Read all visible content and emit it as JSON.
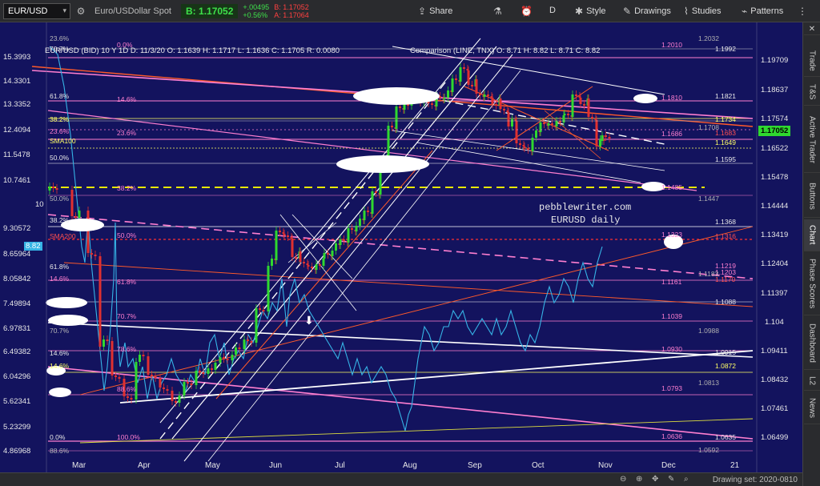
{
  "toolbar": {
    "symbol": "EUR/USD",
    "description": "Euro/USDollar Spot",
    "bid_label": "B:",
    "bid": "1.17052",
    "change": "+.00495",
    "change_pct": "+0.56%",
    "ask_label": "A:",
    "ask": "1.17064",
    "share": "Share",
    "period": "D",
    "style": "Style",
    "drawings": "Drawings",
    "studies": "Studies",
    "patterns": "Patterns"
  },
  "legend": {
    "main": "EUR/USD (BID)  10 Y 1D   D: 11/3/20   O: 1.1639   H: 1.1717   L: 1.1636   C: 1.1705   R: 0.0080",
    "comparison": "Comparison (LINE, TNX)   O: 8.71   H: 8.82   L: 8.71   C: 8.82"
  },
  "watermark": {
    "line1": "pebblewriter.com",
    "line2": "EURUSD daily"
  },
  "left_axis": [
    "15.3993",
    "14.3301",
    "13.3352",
    "12.4094",
    "11.5478",
    "10.7461",
    "10",
    "9.30572",
    "8.65964",
    "8.05842",
    "7.49894",
    "6.97831",
    "6.49382",
    "6.04296",
    "5.62341",
    "5.23299",
    "4.86968"
  ],
  "tnx_value": "8.82",
  "right_axis": [
    "1.19709",
    "1.18637",
    "1.17574",
    "1.16522",
    "1.15478",
    "1.14444",
    "1.13419",
    "1.12404",
    "1.11397",
    "1.104",
    "1.09411",
    "1.08432",
    "1.07461",
    "1.06499"
  ],
  "price_badge": "1.17052",
  "fib_left": [
    "23.6%",
    "70.7%",
    "61.8%",
    "38.2%",
    "23.6%",
    "SMA100",
    "50.0%",
    "50.0%",
    "38.2%",
    "SMA200",
    "61.8%",
    "14.6%",
    "70.7%",
    "14.6%",
    "14.6%",
    "0.0%",
    "88.6%"
  ],
  "fib_mid": [
    "0.0%",
    "14.6%",
    "23.6%",
    "38.2%",
    "50.0%",
    "61.8%",
    "70.7%",
    "78.6%",
    "88.6%",
    "100.0%"
  ],
  "levels_mid": [
    "1.2010",
    "1.1810",
    "1.1686",
    "1.1485",
    "1.1323",
    "1.1161",
    "1.1039",
    "1.0930",
    "1.0793",
    "1.0636"
  ],
  "levels_right": [
    "1.2032",
    "1.1992",
    "1.1821",
    "1.1734",
    "1.1708",
    "1.1683",
    "1.1649",
    "1.1595",
    "1.1447",
    "1.1368",
    "1.1316",
    "1.1219",
    "1.1203",
    "1.1183",
    "1.1170",
    "1.1088",
    "1.0988",
    "1.0915",
    "1.0872",
    "1.0813",
    "1.0635",
    "1.0592"
  ],
  "months": [
    "Mar",
    "Apr",
    "May",
    "Jun",
    "Jul",
    "Aug",
    "Sep",
    "Oct",
    "Nov",
    "Dec",
    "21"
  ],
  "sidebar_tabs": [
    "Trade",
    "T&S",
    "Active Trader",
    "Buttons",
    "Chart",
    "Phase Scores",
    "Dashboard",
    "L2",
    "News"
  ],
  "footer": {
    "drawing_set": "Drawing set: 2020-0810"
  },
  "colors": {
    "background": "#13135e",
    "candle_up": "#2fd82f",
    "candle_down": "#e03030",
    "tnx_line": "#36b4e6",
    "fib_line": "#ff7fd0"
  }
}
